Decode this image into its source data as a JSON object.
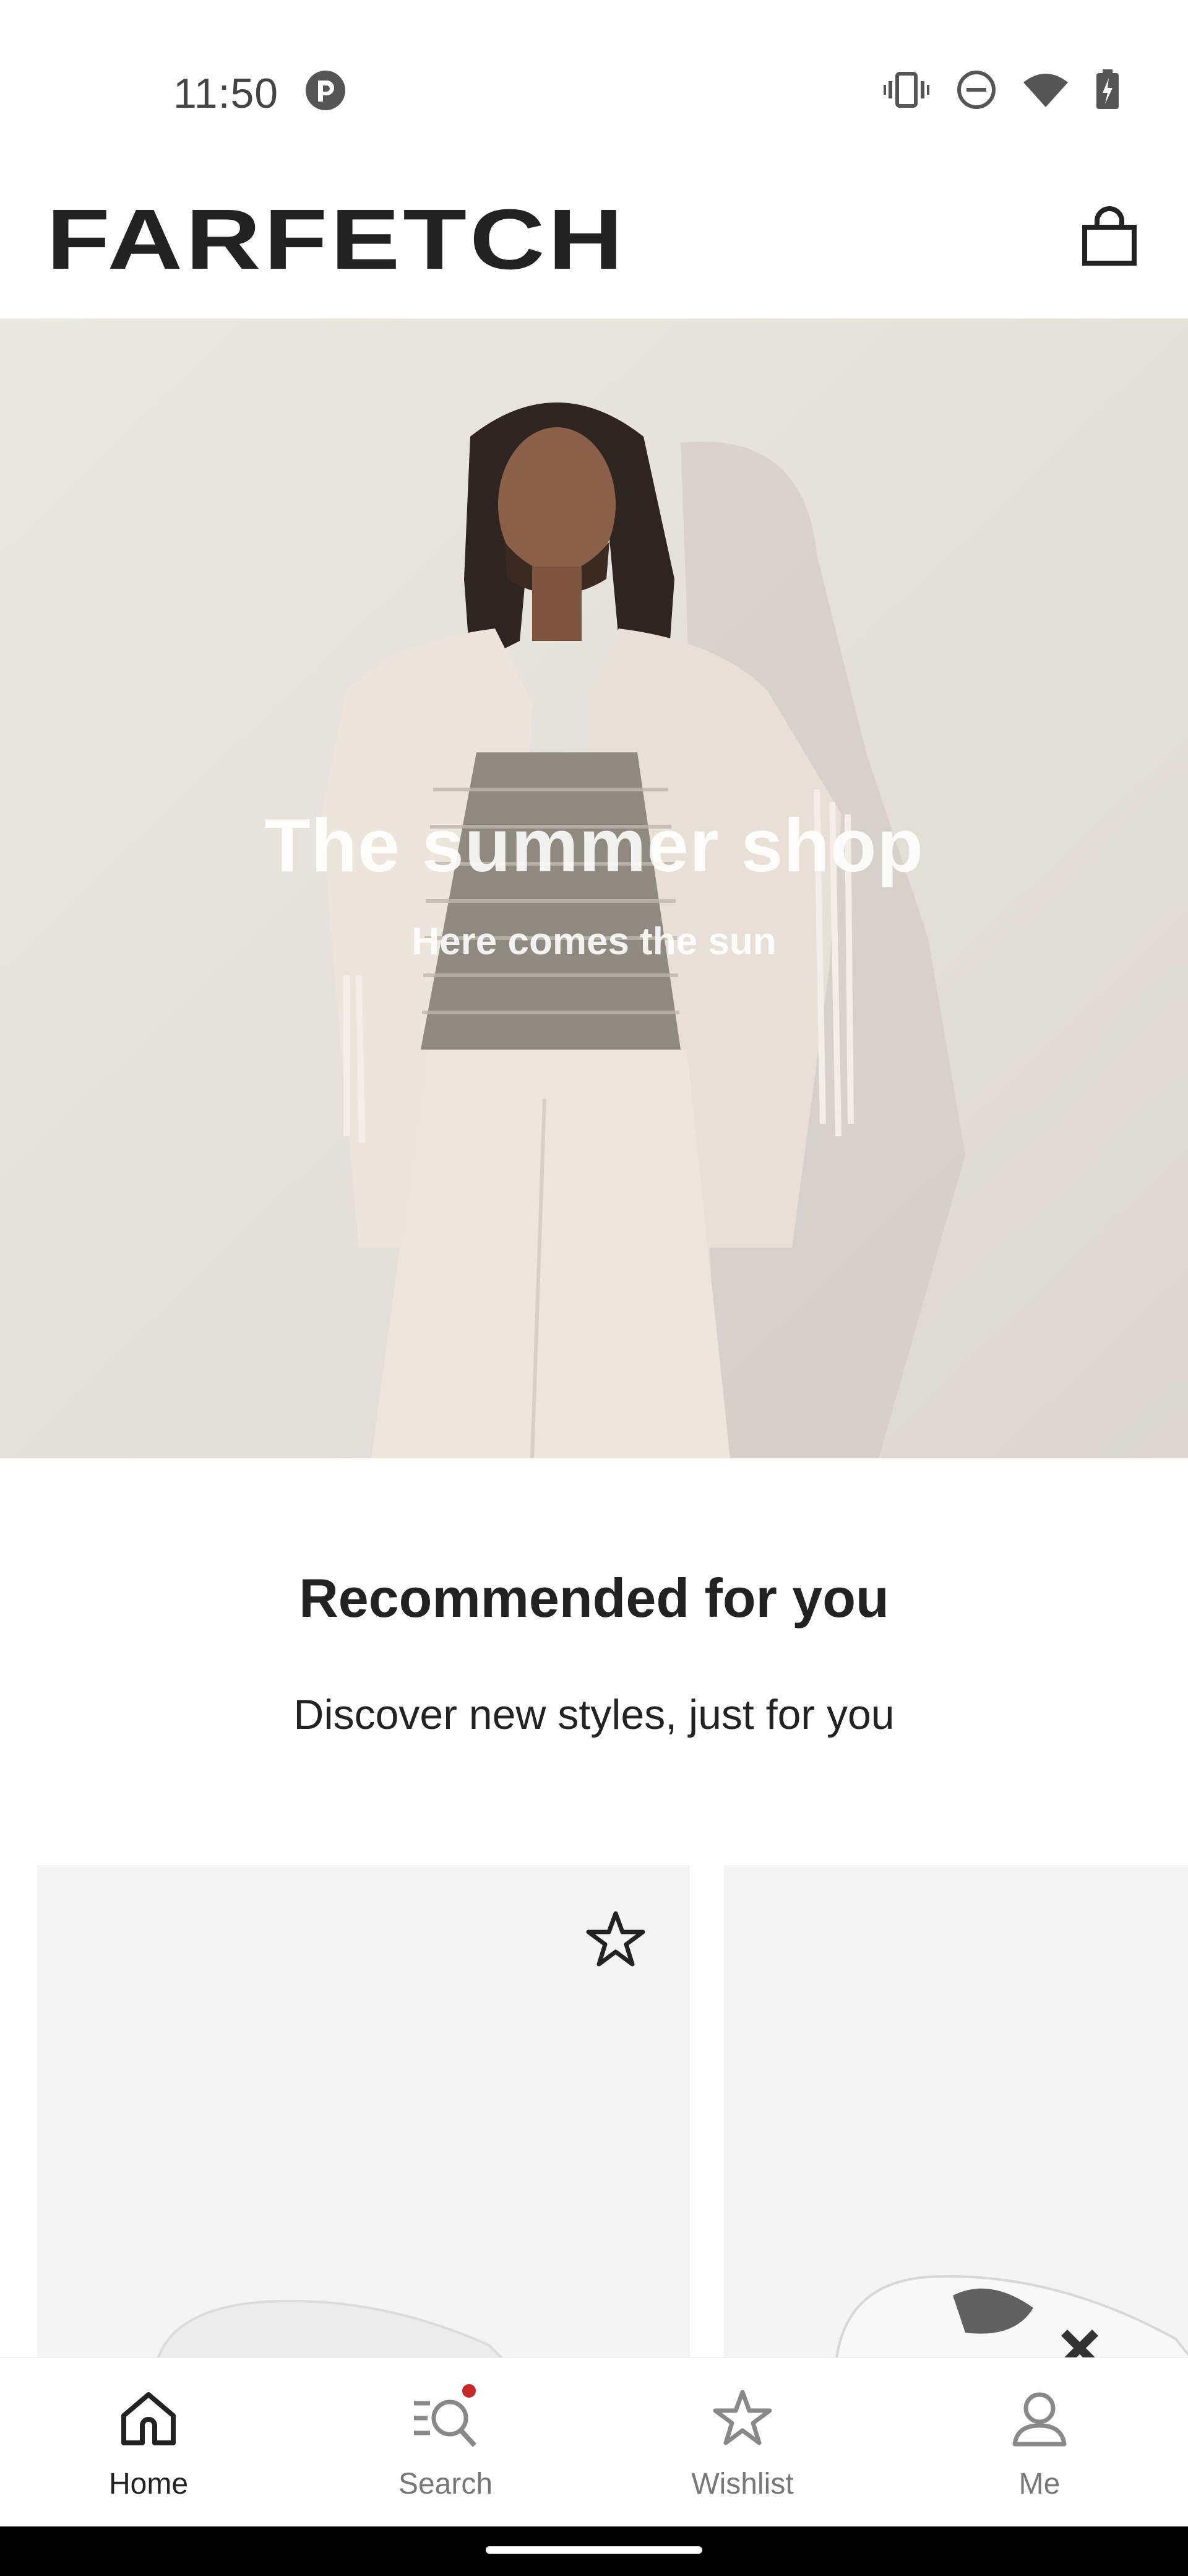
{
  "status_bar": {
    "time": "11:50",
    "icons": [
      "app-notification-icon",
      "vibrate-icon",
      "do-not-disturb-icon",
      "wifi-icon",
      "battery-charging-icon"
    ]
  },
  "header": {
    "brand": "FARFETCH",
    "bag_icon": "shopping-bag-icon"
  },
  "hero": {
    "title": "The summer shop",
    "subtitle": "Here comes the sun"
  },
  "recommended": {
    "title": "Recommended for you",
    "subtitle": "Discover new styles, just for you",
    "products": [
      {
        "wishlist_icon": "star-outline-icon",
        "image": "white-sneaker"
      },
      {
        "image": "printed-white-sneaker"
      }
    ]
  },
  "bottom_nav": {
    "items": [
      {
        "label": "Home",
        "icon": "home-icon",
        "active": true
      },
      {
        "label": "Search",
        "icon": "search-icon",
        "badge": true
      },
      {
        "label": "Wishlist",
        "icon": "star-icon"
      },
      {
        "label": "Me",
        "icon": "profile-icon"
      }
    ]
  },
  "colors": {
    "text": "#222222",
    "muted": "#777777",
    "badge": "#c62828",
    "card_bg": "#f4f4f4"
  }
}
